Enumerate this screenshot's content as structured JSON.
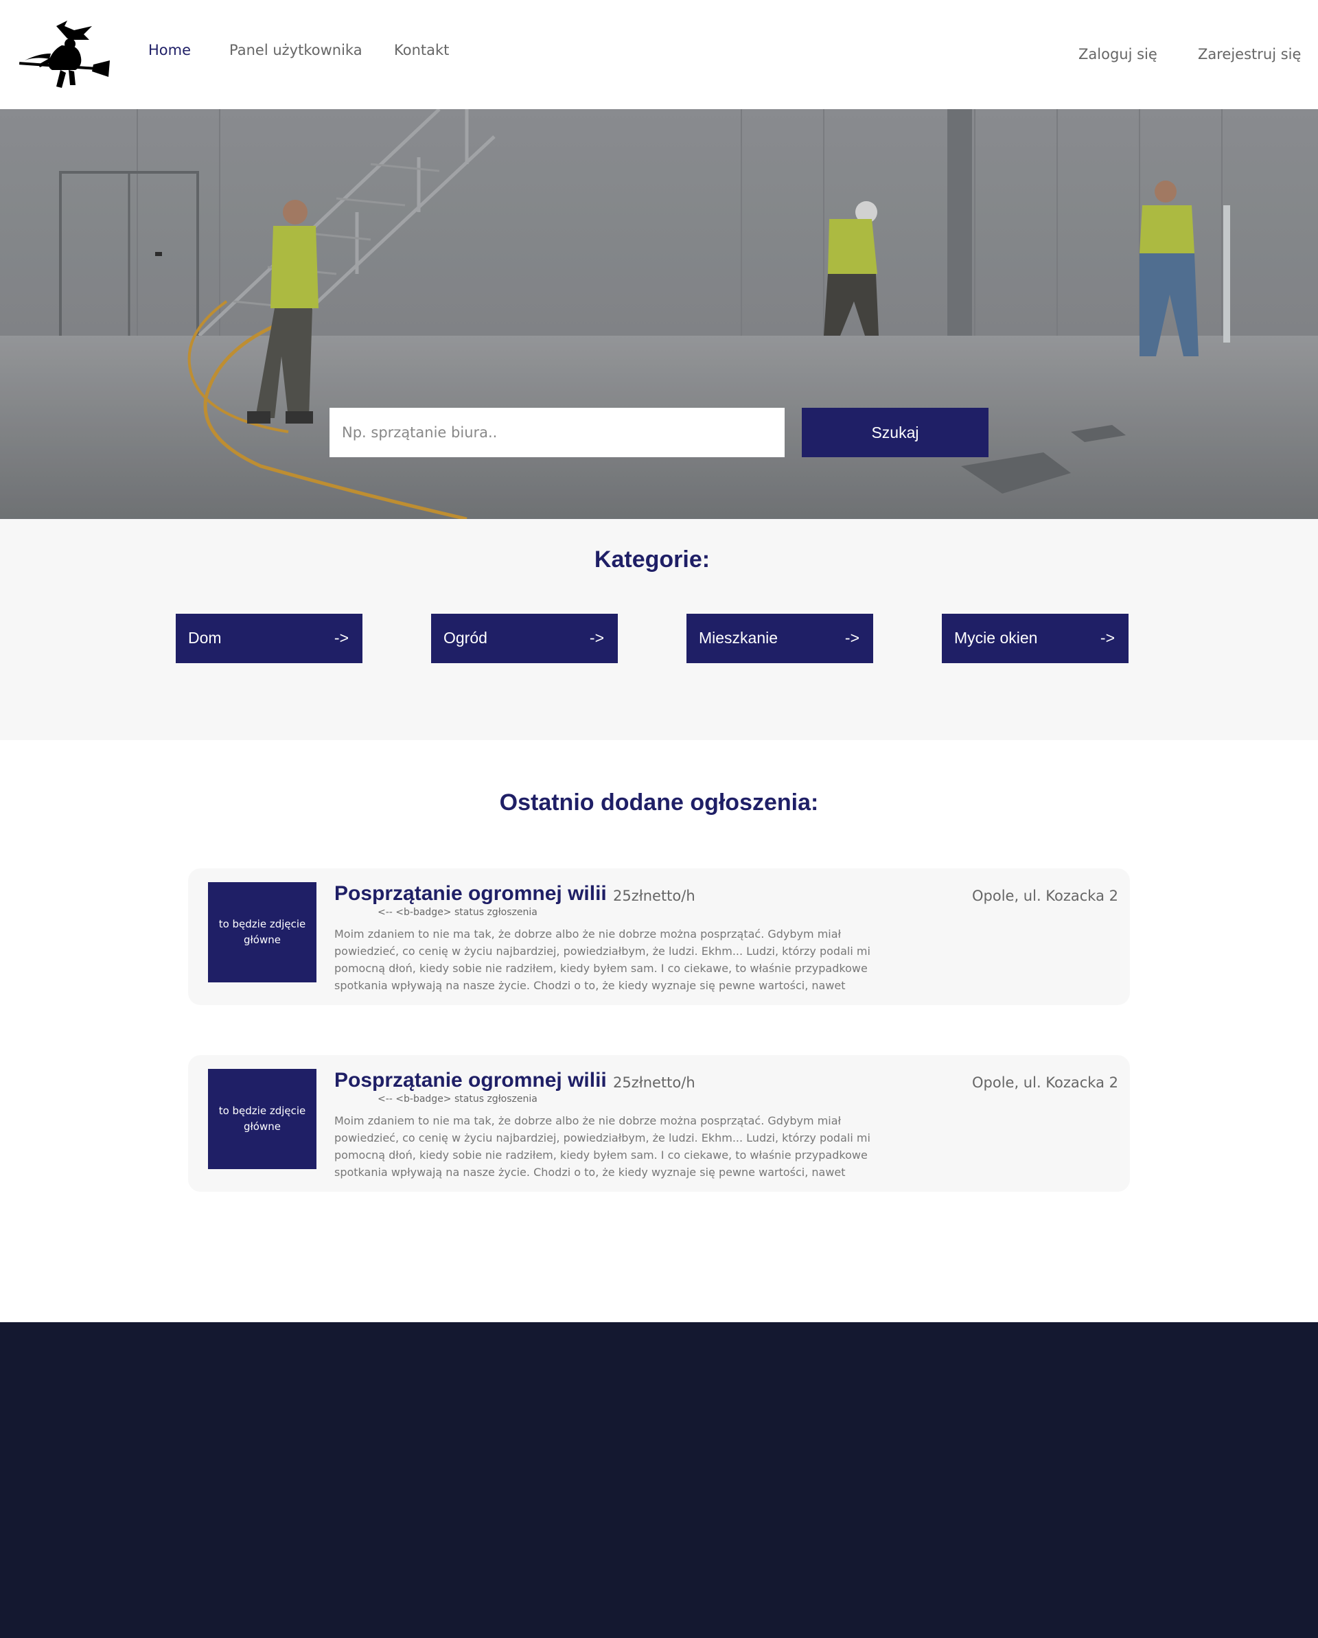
{
  "nav": {
    "links": [
      "Home",
      "Panel użytkownika",
      "Kontakt"
    ],
    "login": "Zaloguj się",
    "register": "Zarejestruj się"
  },
  "search": {
    "placeholder": "Np. sprzątanie biura..",
    "button": "Szukaj"
  },
  "categories": {
    "title": "Kategorie:",
    "items": [
      {
        "label": "Dom",
        "arrow": "->"
      },
      {
        "label": "Ogród",
        "arrow": "->"
      },
      {
        "label": "Mieszkanie",
        "arrow": "->"
      },
      {
        "label": "Mycie okien",
        "arrow": "->"
      }
    ]
  },
  "listings": {
    "title": "Ostatnio dodane ogłoszenia:",
    "items": [
      {
        "image_text": "to będzie zdjęcie główne",
        "title": "Posprzątanie ogromnej wilii",
        "price": "25złnetto/h",
        "badge": "<-- <b-badge> status zgłoszenia",
        "description": "Moim zdaniem to nie ma tak, że dobrze albo że nie dobrze można posprzątać. Gdybym miał powiedzieć, co cenię w życiu najbardziej, powiedziałbym, że ludzi. Ekhm... Ludzi, którzy podali mi pomocną dłoń, kiedy sobie nie radziłem, kiedy byłem sam. I co ciekawe, to właśnie przypadkowe spotkania wpływają na nasze życie. Chodzi o to, że kiedy wyznaje się pewne wartości, nawet",
        "location": "Opole, ul. Kozacka 2"
      },
      {
        "image_text": "to będzie zdjęcie główne",
        "title": "Posprzątanie ogromnej wilii",
        "price": "25złnetto/h",
        "badge": "<-- <b-badge> status zgłoszenia",
        "description": "Moim zdaniem to nie ma tak, że dobrze albo że nie dobrze można posprzątać. Gdybym miał powiedzieć, co cenię w życiu najbardziej, powiedziałbym, że ludzi. Ekhm... Ludzi, którzy podali mi pomocną dłoń, kiedy sobie nie radziłem, kiedy byłem sam. I co ciekawe, to właśnie przypadkowe spotkania wpływają na nasze życie. Chodzi o to, że kiedy wyznaje się pewne wartości, nawet",
        "location": "Opole, ul. Kozacka 2"
      }
    ]
  },
  "colors": {
    "primary": "#1f1f66",
    "footer": "#141830",
    "section_bg": "#f7f7f7"
  }
}
